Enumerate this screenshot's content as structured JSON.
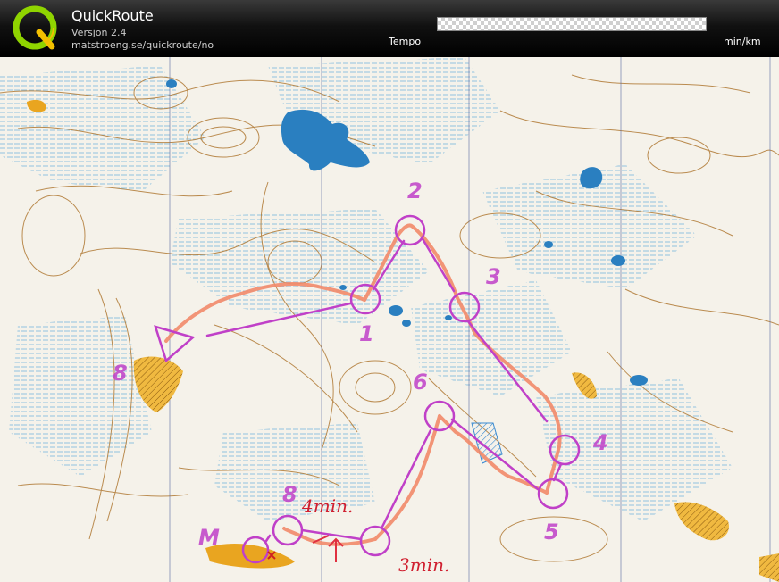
{
  "header": {
    "app_title": "QuickRoute",
    "version": "Versjon 2.4",
    "url": "matstroeng.se/quickroute/no",
    "pace_label": "Tempo",
    "pace_unit": "min/km",
    "logo_letter": "Q"
  },
  "map": {
    "control_labels": [
      {
        "id": "ctrl-1",
        "text": "1"
      },
      {
        "id": "ctrl-2",
        "text": "2"
      },
      {
        "id": "ctrl-3",
        "text": "3"
      },
      {
        "id": "ctrl-4",
        "text": "4"
      },
      {
        "id": "ctrl-5",
        "text": "5"
      },
      {
        "id": "ctrl-6",
        "text": "6"
      },
      {
        "id": "ctrl-8a",
        "text": "8"
      },
      {
        "id": "ctrl-8b",
        "text": "8"
      },
      {
        "id": "start",
        "text": "M"
      }
    ],
    "annotations": {
      "four_min": "4min.",
      "three_min": "3min."
    },
    "colors": {
      "course": "#c040c8",
      "route": "#f28a6a",
      "water": "#2a7fc0",
      "marsh": "#8cc4e0",
      "contour": "#b07a35",
      "yellow": "#e8b040"
    }
  }
}
